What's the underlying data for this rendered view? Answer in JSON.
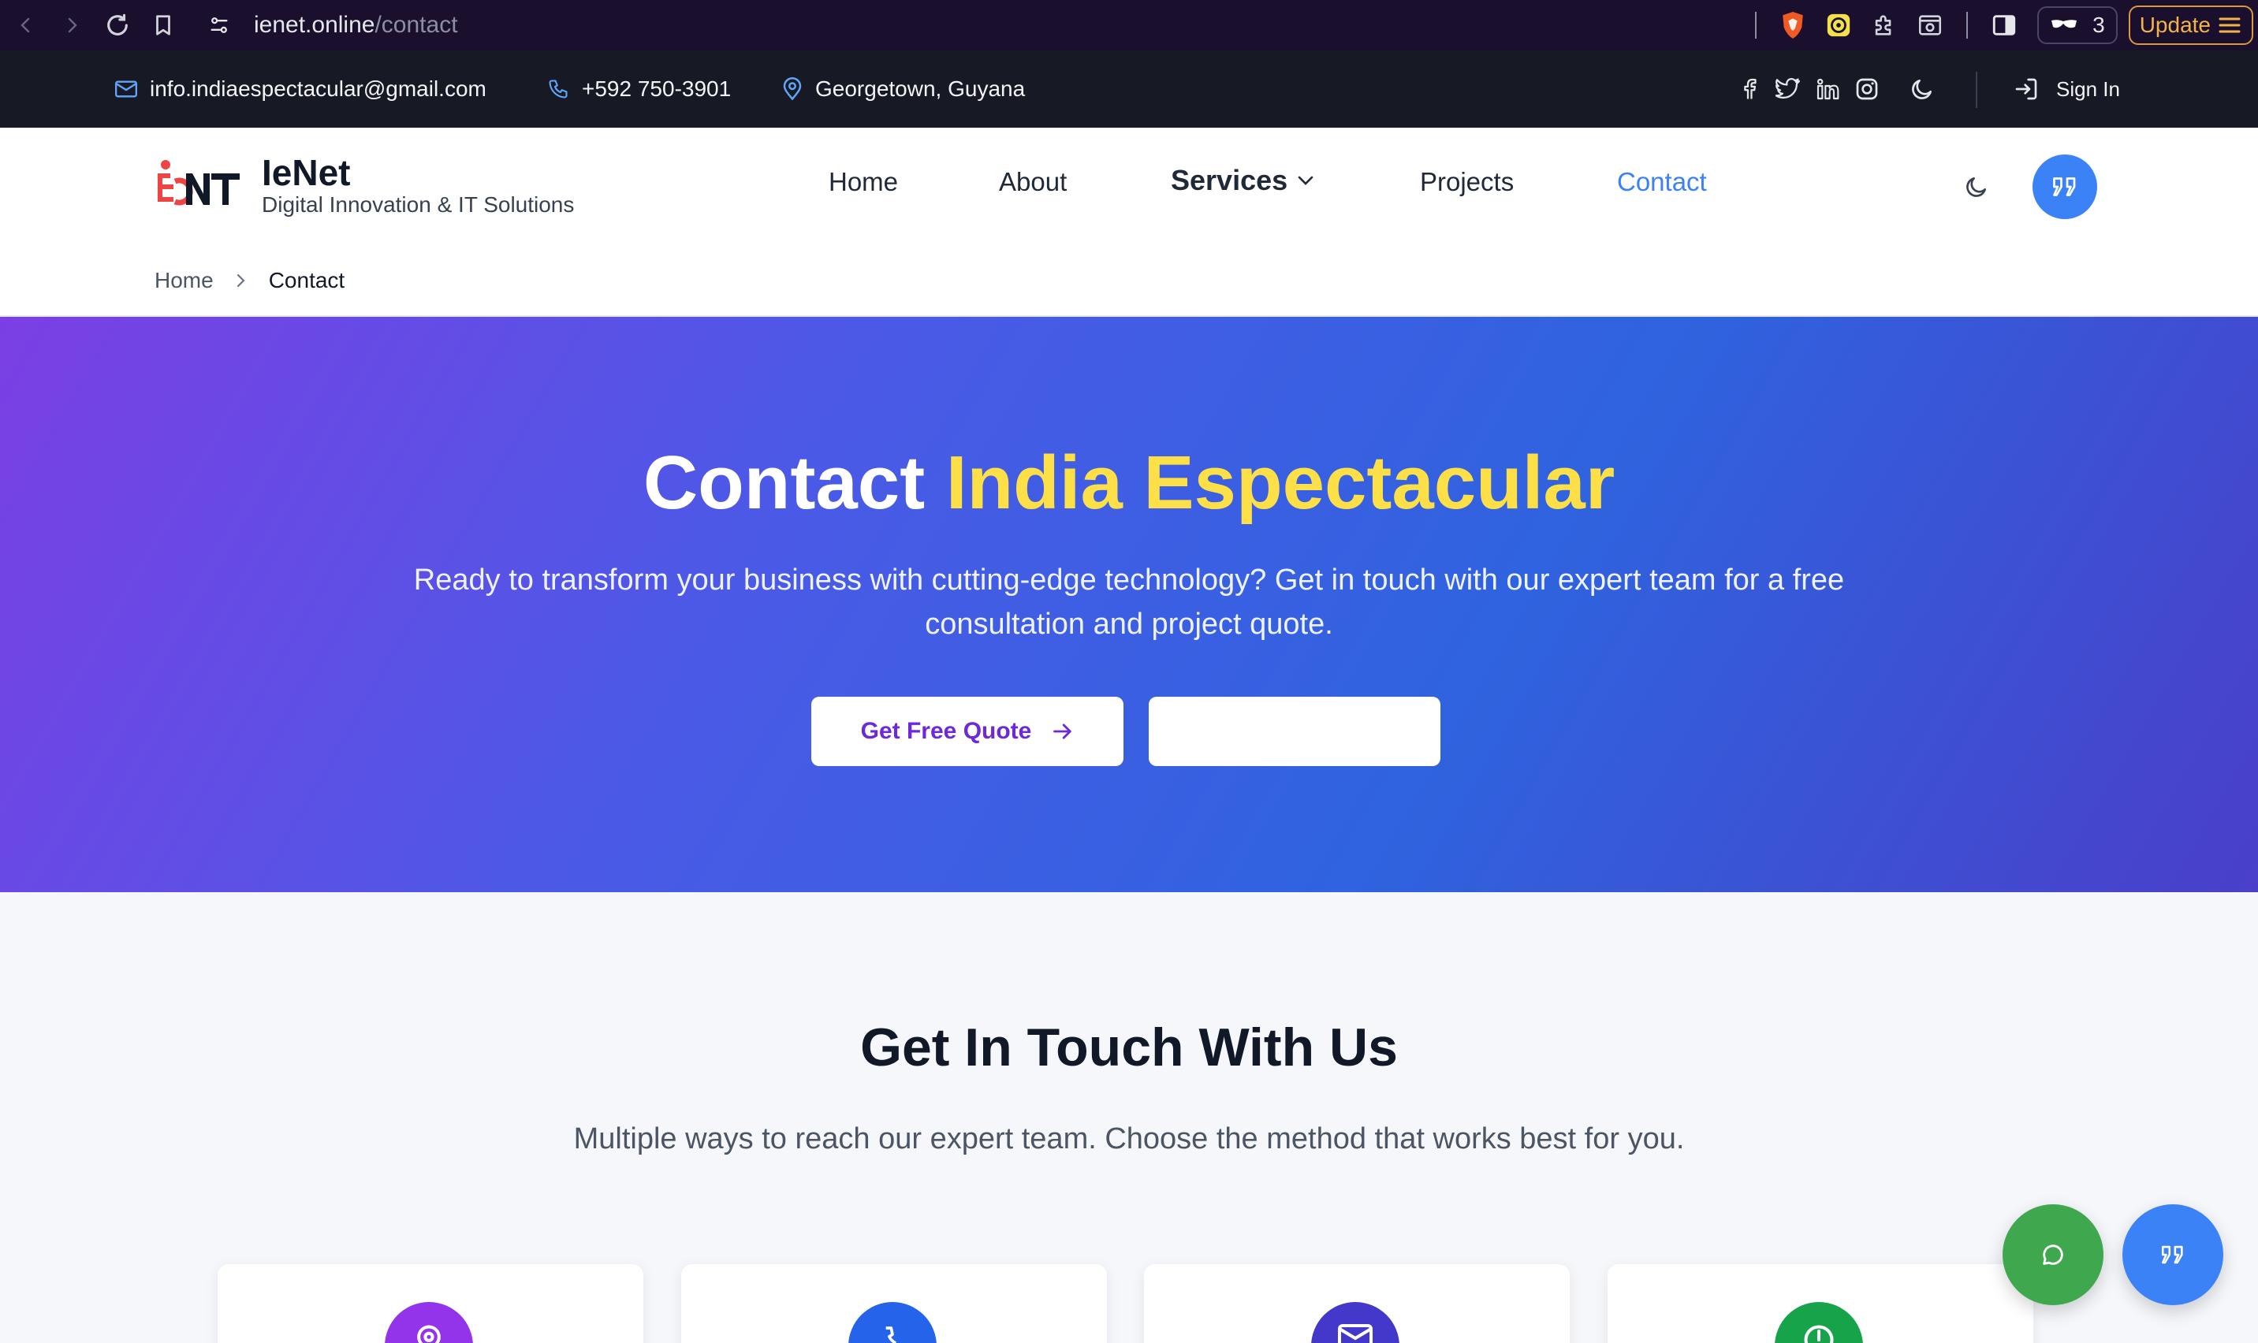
{
  "browser": {
    "url_domain": "ienet.online",
    "url_path": "/contact",
    "extension_count": "3",
    "update_label": "Update"
  },
  "topbar": {
    "email": "info.indiaespectacular@gmail.com",
    "phone": "+592 750-3901",
    "location": "Georgetown, Guyana",
    "sign_in": "Sign In"
  },
  "header": {
    "brand_name": "IeNet",
    "brand_tagline": "Digital Innovation & IT Solutions",
    "nav": {
      "home": "Home",
      "about": "About",
      "services": "Services",
      "projects": "Projects",
      "contact": "Contact"
    },
    "breadcrumb": {
      "home": "Home",
      "current": "Contact"
    }
  },
  "hero": {
    "title_prefix": "Contact",
    "title_highlight": "India Espectacular",
    "subtitle": "Ready to transform your business with cutting-edge technology? Get in touch with our expert team for a free consultation and project quote.",
    "primary_cta": "Get Free Quote",
    "secondary_cta": ""
  },
  "touch": {
    "title": "Get In Touch With Us",
    "subtitle": "Multiple ways to reach our expert team. Choose the method that works best for you.",
    "cards": [
      {
        "icon": "location-icon",
        "color": "#9333ea"
      },
      {
        "icon": "phone-icon",
        "color": "#2563eb"
      },
      {
        "icon": "mail-icon",
        "color": "#4338ca"
      },
      {
        "icon": "clock-icon",
        "color": "#16a34a"
      }
    ]
  },
  "colors": {
    "accent": "#3b82f6",
    "highlight": "#fde047",
    "chat_fab": "#22c55e",
    "quote_fab": "#3b82f6"
  }
}
